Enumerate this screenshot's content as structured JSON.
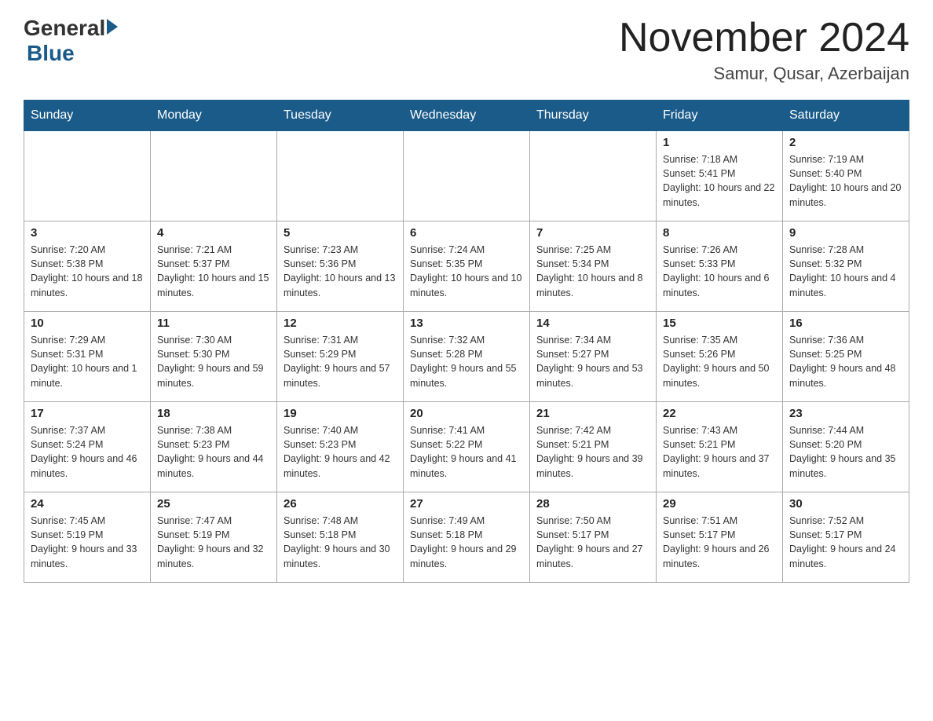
{
  "header": {
    "logo": {
      "general": "General",
      "blue": "Blue"
    },
    "title": "November 2024",
    "location": "Samur, Qusar, Azerbaijan"
  },
  "days_of_week": [
    "Sunday",
    "Monday",
    "Tuesday",
    "Wednesday",
    "Thursday",
    "Friday",
    "Saturday"
  ],
  "weeks": [
    {
      "days": [
        {
          "number": "",
          "info": ""
        },
        {
          "number": "",
          "info": ""
        },
        {
          "number": "",
          "info": ""
        },
        {
          "number": "",
          "info": ""
        },
        {
          "number": "",
          "info": ""
        },
        {
          "number": "1",
          "info": "Sunrise: 7:18 AM\nSunset: 5:41 PM\nDaylight: 10 hours and 22 minutes."
        },
        {
          "number": "2",
          "info": "Sunrise: 7:19 AM\nSunset: 5:40 PM\nDaylight: 10 hours and 20 minutes."
        }
      ]
    },
    {
      "days": [
        {
          "number": "3",
          "info": "Sunrise: 7:20 AM\nSunset: 5:38 PM\nDaylight: 10 hours and 18 minutes."
        },
        {
          "number": "4",
          "info": "Sunrise: 7:21 AM\nSunset: 5:37 PM\nDaylight: 10 hours and 15 minutes."
        },
        {
          "number": "5",
          "info": "Sunrise: 7:23 AM\nSunset: 5:36 PM\nDaylight: 10 hours and 13 minutes."
        },
        {
          "number": "6",
          "info": "Sunrise: 7:24 AM\nSunset: 5:35 PM\nDaylight: 10 hours and 10 minutes."
        },
        {
          "number": "7",
          "info": "Sunrise: 7:25 AM\nSunset: 5:34 PM\nDaylight: 10 hours and 8 minutes."
        },
        {
          "number": "8",
          "info": "Sunrise: 7:26 AM\nSunset: 5:33 PM\nDaylight: 10 hours and 6 minutes."
        },
        {
          "number": "9",
          "info": "Sunrise: 7:28 AM\nSunset: 5:32 PM\nDaylight: 10 hours and 4 minutes."
        }
      ]
    },
    {
      "days": [
        {
          "number": "10",
          "info": "Sunrise: 7:29 AM\nSunset: 5:31 PM\nDaylight: 10 hours and 1 minute."
        },
        {
          "number": "11",
          "info": "Sunrise: 7:30 AM\nSunset: 5:30 PM\nDaylight: 9 hours and 59 minutes."
        },
        {
          "number": "12",
          "info": "Sunrise: 7:31 AM\nSunset: 5:29 PM\nDaylight: 9 hours and 57 minutes."
        },
        {
          "number": "13",
          "info": "Sunrise: 7:32 AM\nSunset: 5:28 PM\nDaylight: 9 hours and 55 minutes."
        },
        {
          "number": "14",
          "info": "Sunrise: 7:34 AM\nSunset: 5:27 PM\nDaylight: 9 hours and 53 minutes."
        },
        {
          "number": "15",
          "info": "Sunrise: 7:35 AM\nSunset: 5:26 PM\nDaylight: 9 hours and 50 minutes."
        },
        {
          "number": "16",
          "info": "Sunrise: 7:36 AM\nSunset: 5:25 PM\nDaylight: 9 hours and 48 minutes."
        }
      ]
    },
    {
      "days": [
        {
          "number": "17",
          "info": "Sunrise: 7:37 AM\nSunset: 5:24 PM\nDaylight: 9 hours and 46 minutes."
        },
        {
          "number": "18",
          "info": "Sunrise: 7:38 AM\nSunset: 5:23 PM\nDaylight: 9 hours and 44 minutes."
        },
        {
          "number": "19",
          "info": "Sunrise: 7:40 AM\nSunset: 5:23 PM\nDaylight: 9 hours and 42 minutes."
        },
        {
          "number": "20",
          "info": "Sunrise: 7:41 AM\nSunset: 5:22 PM\nDaylight: 9 hours and 41 minutes."
        },
        {
          "number": "21",
          "info": "Sunrise: 7:42 AM\nSunset: 5:21 PM\nDaylight: 9 hours and 39 minutes."
        },
        {
          "number": "22",
          "info": "Sunrise: 7:43 AM\nSunset: 5:21 PM\nDaylight: 9 hours and 37 minutes."
        },
        {
          "number": "23",
          "info": "Sunrise: 7:44 AM\nSunset: 5:20 PM\nDaylight: 9 hours and 35 minutes."
        }
      ]
    },
    {
      "days": [
        {
          "number": "24",
          "info": "Sunrise: 7:45 AM\nSunset: 5:19 PM\nDaylight: 9 hours and 33 minutes."
        },
        {
          "number": "25",
          "info": "Sunrise: 7:47 AM\nSunset: 5:19 PM\nDaylight: 9 hours and 32 minutes."
        },
        {
          "number": "26",
          "info": "Sunrise: 7:48 AM\nSunset: 5:18 PM\nDaylight: 9 hours and 30 minutes."
        },
        {
          "number": "27",
          "info": "Sunrise: 7:49 AM\nSunset: 5:18 PM\nDaylight: 9 hours and 29 minutes."
        },
        {
          "number": "28",
          "info": "Sunrise: 7:50 AM\nSunset: 5:17 PM\nDaylight: 9 hours and 27 minutes."
        },
        {
          "number": "29",
          "info": "Sunrise: 7:51 AM\nSunset: 5:17 PM\nDaylight: 9 hours and 26 minutes."
        },
        {
          "number": "30",
          "info": "Sunrise: 7:52 AM\nSunset: 5:17 PM\nDaylight: 9 hours and 24 minutes."
        }
      ]
    }
  ]
}
